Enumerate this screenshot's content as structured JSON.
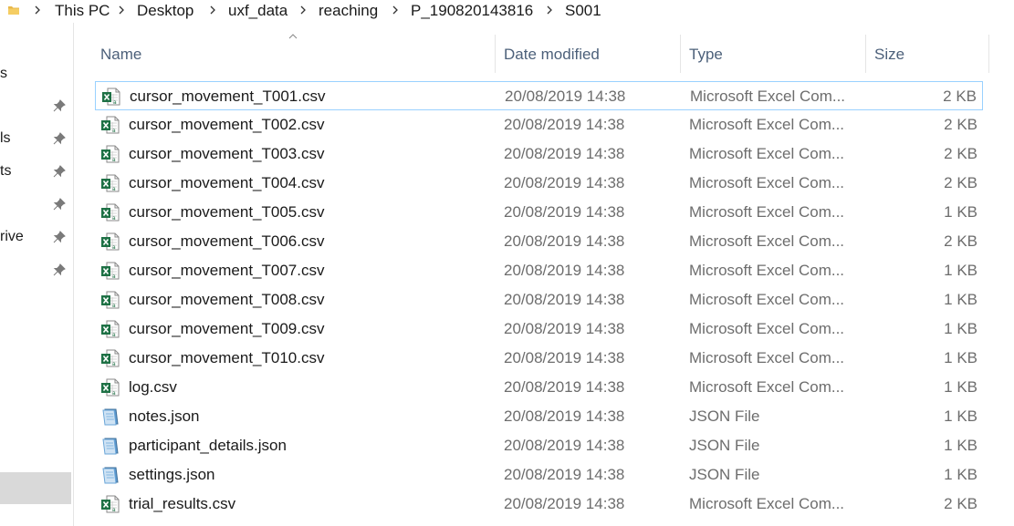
{
  "breadcrumb": {
    "items": [
      "This PC",
      "Desktop",
      "uxf_data",
      "reaching",
      "P_190820143816",
      "S001"
    ]
  },
  "nav": {
    "items": [
      {
        "label": "s",
        "pinned": false
      },
      {
        "label": "",
        "pinned": true
      },
      {
        "label": "ls",
        "pinned": true
      },
      {
        "label": "ts",
        "pinned": true
      },
      {
        "label": "",
        "pinned": true
      },
      {
        "label": "rive",
        "pinned": true
      },
      {
        "label": "",
        "pinned": true
      }
    ]
  },
  "columns": {
    "name": "Name",
    "date": "Date modified",
    "type": "Type",
    "size": "Size"
  },
  "colors": {
    "header_text": "#4c607a",
    "selection_border": "#99d1ff",
    "excel_green": "#1e7145",
    "json_blue": "#6aa6d8"
  },
  "files": [
    {
      "name": "cursor_movement_T001.csv",
      "date": "20/08/2019 14:38",
      "type": "Microsoft Excel Com...",
      "size": "2 KB",
      "icon": "excel-csv-icon",
      "selected": true
    },
    {
      "name": "cursor_movement_T002.csv",
      "date": "20/08/2019 14:38",
      "type": "Microsoft Excel Com...",
      "size": "2 KB",
      "icon": "excel-csv-icon"
    },
    {
      "name": "cursor_movement_T003.csv",
      "date": "20/08/2019 14:38",
      "type": "Microsoft Excel Com...",
      "size": "2 KB",
      "icon": "excel-csv-icon"
    },
    {
      "name": "cursor_movement_T004.csv",
      "date": "20/08/2019 14:38",
      "type": "Microsoft Excel Com...",
      "size": "2 KB",
      "icon": "excel-csv-icon"
    },
    {
      "name": "cursor_movement_T005.csv",
      "date": "20/08/2019 14:38",
      "type": "Microsoft Excel Com...",
      "size": "1 KB",
      "icon": "excel-csv-icon"
    },
    {
      "name": "cursor_movement_T006.csv",
      "date": "20/08/2019 14:38",
      "type": "Microsoft Excel Com...",
      "size": "2 KB",
      "icon": "excel-csv-icon"
    },
    {
      "name": "cursor_movement_T007.csv",
      "date": "20/08/2019 14:38",
      "type": "Microsoft Excel Com...",
      "size": "1 KB",
      "icon": "excel-csv-icon"
    },
    {
      "name": "cursor_movement_T008.csv",
      "date": "20/08/2019 14:38",
      "type": "Microsoft Excel Com...",
      "size": "1 KB",
      "icon": "excel-csv-icon"
    },
    {
      "name": "cursor_movement_T009.csv",
      "date": "20/08/2019 14:38",
      "type": "Microsoft Excel Com...",
      "size": "1 KB",
      "icon": "excel-csv-icon"
    },
    {
      "name": "cursor_movement_T010.csv",
      "date": "20/08/2019 14:38",
      "type": "Microsoft Excel Com...",
      "size": "1 KB",
      "icon": "excel-csv-icon"
    },
    {
      "name": "log.csv",
      "date": "20/08/2019 14:38",
      "type": "Microsoft Excel Com...",
      "size": "1 KB",
      "icon": "excel-csv-icon"
    },
    {
      "name": "notes.json",
      "date": "20/08/2019 14:38",
      "type": "JSON File",
      "size": "1 KB",
      "icon": "json-file-icon"
    },
    {
      "name": "participant_details.json",
      "date": "20/08/2019 14:38",
      "type": "JSON File",
      "size": "1 KB",
      "icon": "json-file-icon"
    },
    {
      "name": "settings.json",
      "date": "20/08/2019 14:38",
      "type": "JSON File",
      "size": "1 KB",
      "icon": "json-file-icon"
    },
    {
      "name": "trial_results.csv",
      "date": "20/08/2019 14:38",
      "type": "Microsoft Excel Com...",
      "size": "2 KB",
      "icon": "excel-csv-icon"
    }
  ]
}
